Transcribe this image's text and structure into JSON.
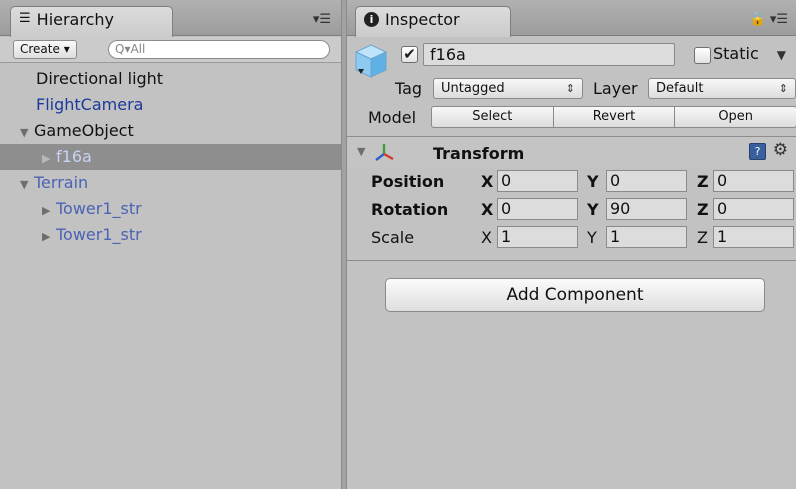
{
  "hierarchy": {
    "tab_label": "Hierarchy",
    "create_label": "Create ▾",
    "search_placeholder": "Q▾All",
    "items": [
      {
        "label": "Directional light"
      },
      {
        "label": "FlightCamera"
      },
      {
        "label": "GameObject"
      },
      {
        "label": "f16a"
      },
      {
        "label": "Terrain"
      },
      {
        "label": "Tower1_str"
      },
      {
        "label": "Tower1_str"
      }
    ]
  },
  "inspector": {
    "tab_label": "Inspector",
    "object_name": "f16a",
    "active_checked": "✔",
    "static_label": "Static",
    "tag_label": "Tag",
    "tag_value": "Untagged",
    "layer_label": "Layer",
    "layer_value": "Default",
    "model_label": "Model",
    "model_buttons": [
      "Select",
      "Revert",
      "Open"
    ],
    "component": {
      "title": "Transform",
      "rows": [
        {
          "label": "Position",
          "x": "0",
          "y": "0",
          "z": "0"
        },
        {
          "label": "Rotation",
          "x": "0",
          "y": "90",
          "z": "0"
        },
        {
          "label": "Scale",
          "x": "1",
          "y": "1",
          "z": "1"
        }
      ]
    },
    "add_component_label": "Add Component"
  },
  "colors": {
    "panel_bg": "#c2c2c2",
    "selection": "#8e8e8e",
    "prefab_blue": "#1c3a9a"
  }
}
